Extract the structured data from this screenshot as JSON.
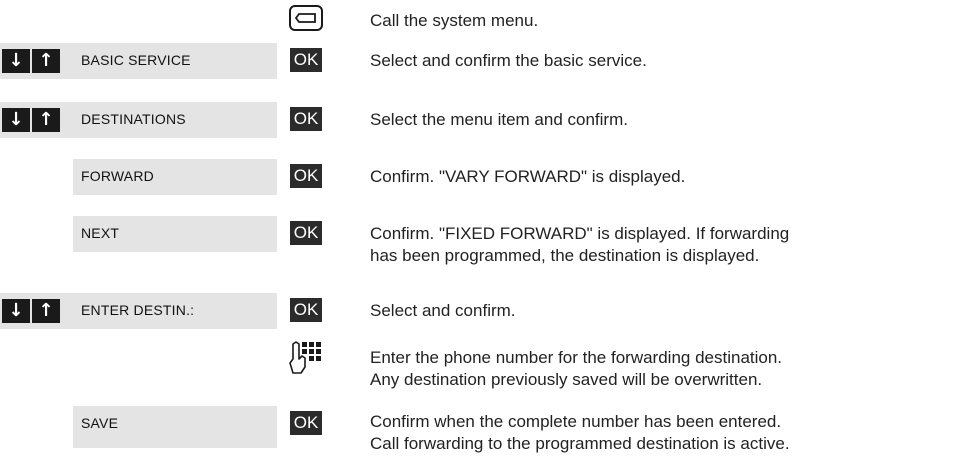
{
  "step_menu": {
    "icon": "menu-key-icon",
    "text": "Call the system menu."
  },
  "step_basic": {
    "display": "BASIC SERVICE",
    "ok": "OK",
    "text": "Select and confirm the basic service."
  },
  "step_dest": {
    "display": "DESTINATIONS",
    "ok": "OK",
    "text": "Select the menu item and confirm."
  },
  "step_forward": {
    "display": "FORWARD",
    "ok": "OK",
    "text": "Confirm. \"VARY FORWARD\" is displayed."
  },
  "step_next": {
    "display": "NEXT",
    "ok": "OK",
    "text_line1": "Confirm. \"FIXED FORWARD\" is displayed. If forwarding",
    "text_line2": "has been programmed, the destination is displayed."
  },
  "step_enter": {
    "display": "ENTER DESTIN.:",
    "ok": "OK",
    "text": "Select and confirm."
  },
  "step_keypad": {
    "icon": "keypad-icon",
    "text_line1": "Enter the phone number for the forwarding destination.",
    "text_line2": "Any destination previously saved will be overwritten."
  },
  "step_save": {
    "display": "SAVE",
    "ok": "OK",
    "text_line1": "Confirm when the complete number has been entered.",
    "text_line2": "Call forwarding to the programmed destination is active."
  }
}
